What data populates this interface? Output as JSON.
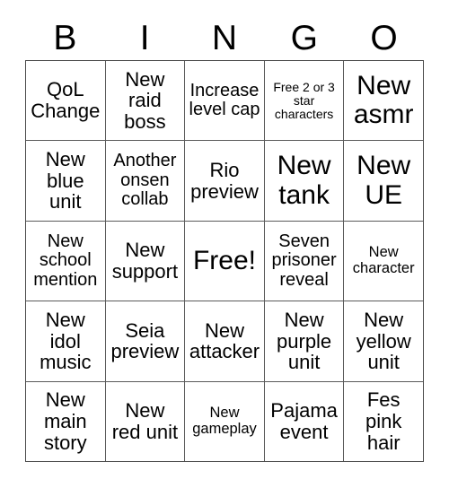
{
  "card": {
    "headers": [
      "B",
      "I",
      "N",
      "G",
      "O"
    ],
    "cells": [
      [
        {
          "text": "QoL Change",
          "size": "l",
          "free": false
        },
        {
          "text": "New raid boss",
          "size": "l",
          "free": false
        },
        {
          "text": "Increase level cap",
          "size": "m",
          "free": false
        },
        {
          "text": "Free 2 or 3 star characters",
          "size": "xs",
          "free": false
        },
        {
          "text": "New asmr",
          "size": "xl",
          "free": false
        }
      ],
      [
        {
          "text": "New blue unit",
          "size": "l",
          "free": false
        },
        {
          "text": "Another onsen collab",
          "size": "m",
          "free": false
        },
        {
          "text": "Rio preview",
          "size": "l",
          "free": false
        },
        {
          "text": "New tank",
          "size": "xl",
          "free": false
        },
        {
          "text": "New UE",
          "size": "xl",
          "free": false
        }
      ],
      [
        {
          "text": "New school mention",
          "size": "m",
          "free": false
        },
        {
          "text": "New support",
          "size": "l",
          "free": false
        },
        {
          "text": "Free!",
          "size": "xl",
          "free": true
        },
        {
          "text": "Seven prisoner reveal",
          "size": "m",
          "free": false
        },
        {
          "text": "New character",
          "size": "s",
          "free": false
        }
      ],
      [
        {
          "text": "New idol music",
          "size": "l",
          "free": false
        },
        {
          "text": "Seia preview",
          "size": "l",
          "free": false
        },
        {
          "text": "New attacker",
          "size": "l",
          "free": false
        },
        {
          "text": "New purple unit",
          "size": "l",
          "free": false
        },
        {
          "text": "New yellow unit",
          "size": "l",
          "free": false
        }
      ],
      [
        {
          "text": "New main story",
          "size": "l",
          "free": false
        },
        {
          "text": "New red unit",
          "size": "l",
          "free": false
        },
        {
          "text": "New gameplay",
          "size": "s",
          "free": false
        },
        {
          "text": "Pajama event",
          "size": "l",
          "free": false
        },
        {
          "text": "Fes pink hair",
          "size": "l",
          "free": false
        }
      ]
    ]
  },
  "colors": {
    "background": "#ffffff",
    "cell_background": "#ffffff",
    "text": "#000000",
    "grid_line": "#5a5a5a"
  }
}
